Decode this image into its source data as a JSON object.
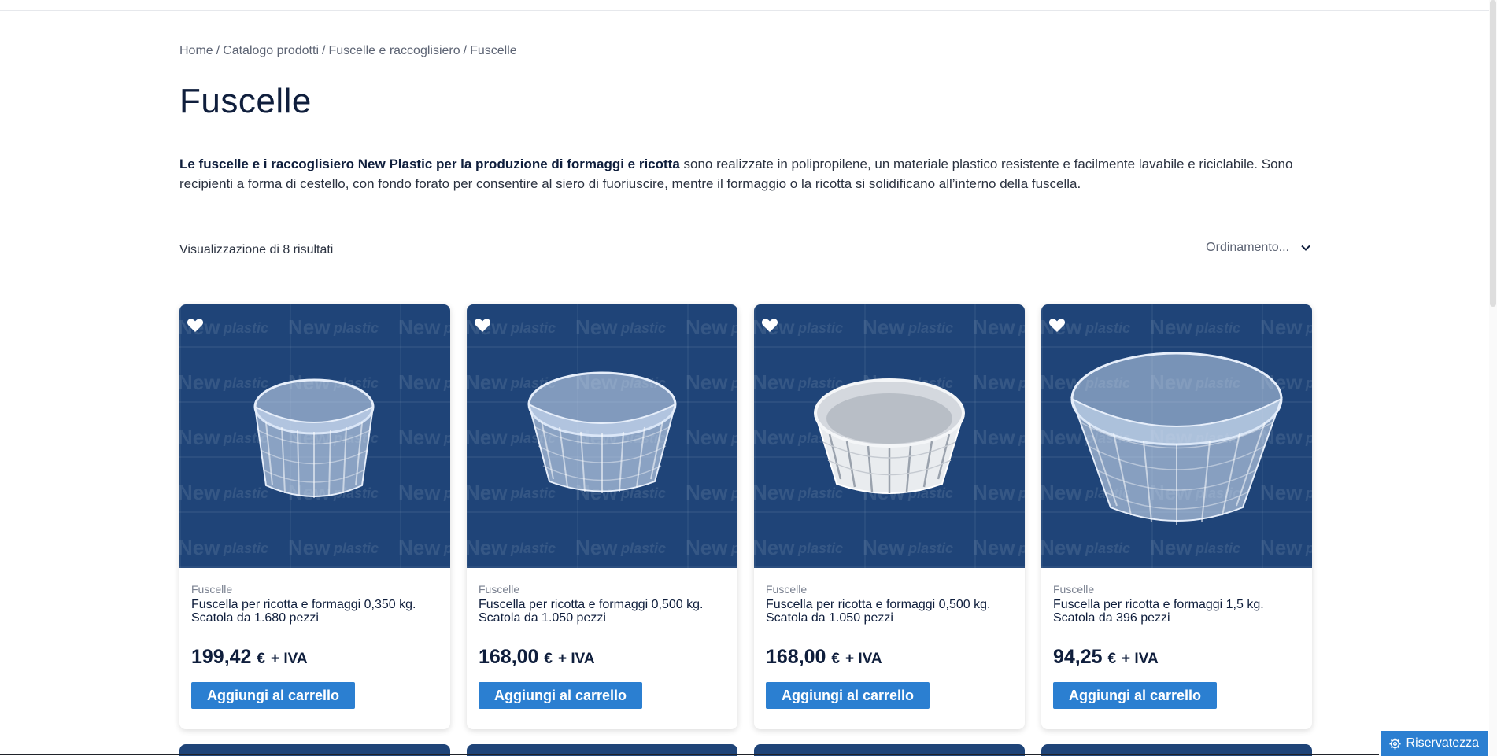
{
  "breadcrumb": {
    "items": [
      "Home",
      "Catalogo prodotti",
      "Fuscelle e raccoglisiero",
      "Fuscelle"
    ],
    "separator": "/"
  },
  "page": {
    "title": "Fuscelle",
    "intro_bold": "Le fuscelle e i raccoglisiero New Plastic per la produzione di formaggi e ricotta",
    "intro_text": " sono realizzate in polipropilene, un materiale plastico resistente e facilmente lavabile e riciclabile. Sono recipienti a forma di cestello, con fondo forato per consentire al siero di fuoriuscire, mentre il formaggio o la ricotta si solidificano all’interno della fuscella."
  },
  "toolbar": {
    "results_text": "Visualizzazione di 8 risultati",
    "sort_label": "Ordinamento..."
  },
  "products": [
    {
      "category": "Fuscelle",
      "name": "Fuscella per ricotta e formaggi 0,350 kg. Scatola da 1.680 pezzi",
      "price": "199,42",
      "currency": "€",
      "tax": "+ IVA",
      "button": "Aggiungi al carrello",
      "basket_color": "clear"
    },
    {
      "category": "Fuscelle",
      "name": "Fuscella per ricotta e formaggi 0,500 kg. Scatola da 1.050 pezzi",
      "price": "168,00",
      "currency": "€",
      "tax": "+ IVA",
      "button": "Aggiungi al carrello",
      "basket_color": "clear"
    },
    {
      "category": "Fuscelle",
      "name": "Fuscella per ricotta e formaggi 0,500 kg. Scatola da 1.050 pezzi",
      "price": "168,00",
      "currency": "€",
      "tax": "+ IVA",
      "button": "Aggiungi al carrello",
      "basket_color": "white"
    },
    {
      "category": "Fuscelle",
      "name": "Fuscella per ricotta e formaggi 1,5 kg. Scatola da 396 pezzi",
      "price": "94,25",
      "currency": "€",
      "tax": "+ IVA",
      "button": "Aggiungi al carrello",
      "basket_color": "clear"
    }
  ],
  "watermark_text": "New plastic",
  "privacy": {
    "label": "Riservatezza"
  },
  "colors": {
    "card_image_bg": "#1f4478",
    "button": "#2b7fd1",
    "title": "#0f1e3c",
    "text": "#2b3240",
    "muted": "#7a8190"
  },
  "icons": {
    "wishlist": "heart-icon",
    "sort": "chevron-down-icon",
    "privacy": "gear-icon"
  }
}
